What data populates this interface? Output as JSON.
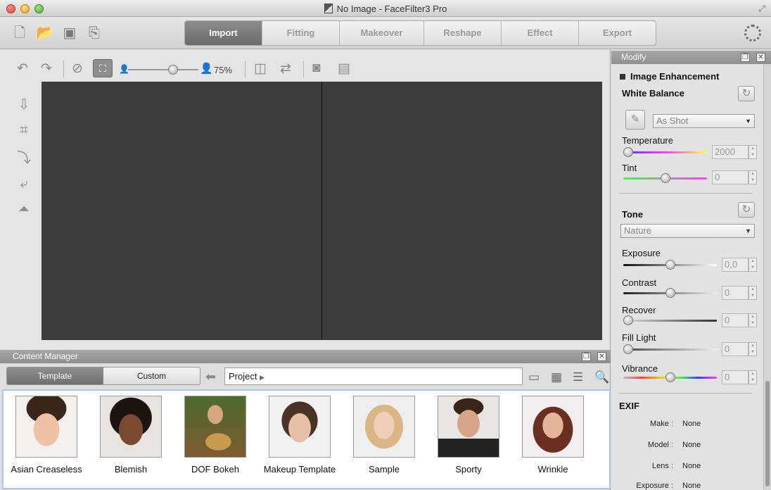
{
  "window": {
    "title": "No Image - FaceFilter3 Pro"
  },
  "toolbar": {
    "tabs": [
      {
        "label": "Import",
        "active": true
      },
      {
        "label": "Fitting",
        "active": false
      },
      {
        "label": "Makeover",
        "active": false
      },
      {
        "label": "Reshape",
        "active": false
      },
      {
        "label": "Effect",
        "active": false
      },
      {
        "label": "Export",
        "active": false
      }
    ]
  },
  "view": {
    "zoom_label": "75%",
    "zoom_percent": 75
  },
  "content_manager": {
    "title": "Content Manager",
    "tabs": [
      {
        "label": "Template",
        "active": true
      },
      {
        "label": "Custom",
        "active": false
      }
    ],
    "path": "Project",
    "templates": [
      {
        "label": "Asian Creaseless"
      },
      {
        "label": "Blemish"
      },
      {
        "label": "DOF Bokeh"
      },
      {
        "label": "Makeup Template"
      },
      {
        "label": "Sample"
      },
      {
        "label": "Sporty"
      },
      {
        "label": "Wrinkle"
      }
    ]
  },
  "modify": {
    "title": "Modify",
    "section": "Image Enhancement",
    "white_balance": {
      "title": "White Balance",
      "preset": "As Shot",
      "temperature": {
        "label": "Temperature",
        "value": "2000",
        "fraction": 0.0
      },
      "tint": {
        "label": "Tint",
        "value": "0",
        "fraction": 0.5
      }
    },
    "tone": {
      "title": "Tone",
      "preset": "Nature",
      "exposure": {
        "label": "Exposure",
        "value": "0,0",
        "fraction": 0.5
      },
      "contrast": {
        "label": "Contrast",
        "value": "0",
        "fraction": 0.5
      },
      "recover": {
        "label": "Recover",
        "value": "0",
        "fraction": 0.0
      },
      "fill_light": {
        "label": "Fill Light",
        "value": "0",
        "fraction": 0.0
      },
      "vibrance": {
        "label": "Vibrance",
        "value": "0",
        "fraction": 0.5
      }
    },
    "exif": {
      "title": "EXIF",
      "rows": [
        {
          "key": "Make :",
          "value": "None"
        },
        {
          "key": "Model :",
          "value": "None"
        },
        {
          "key": "Lens :",
          "value": "None"
        },
        {
          "key": "Exposure :",
          "value": "None"
        }
      ]
    }
  }
}
